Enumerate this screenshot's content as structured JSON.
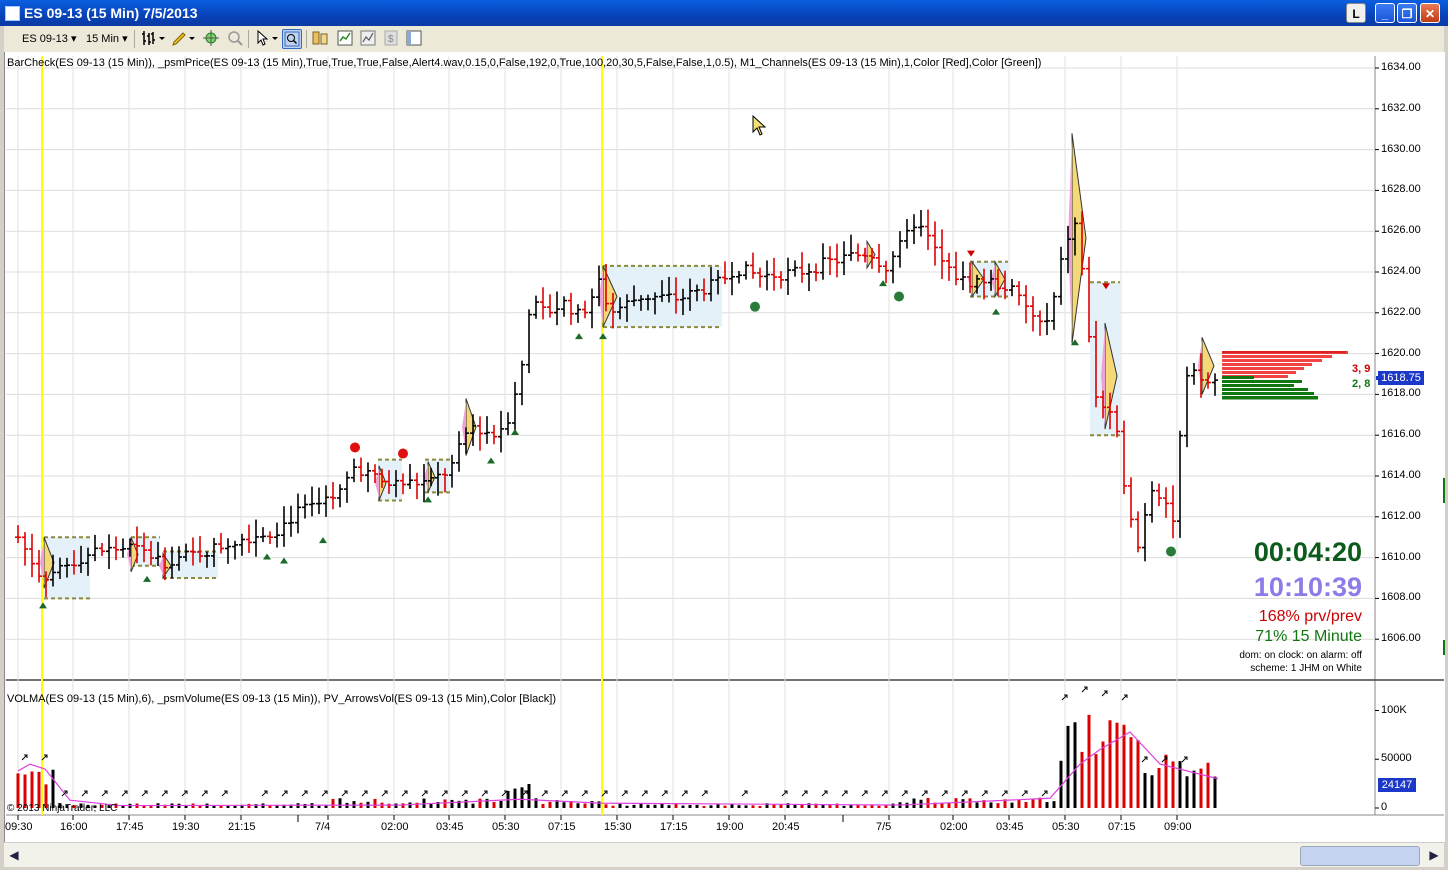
{
  "window": {
    "title": "ES 09-13 (15 Min)  7/5/2013",
    "btn_l": "L",
    "btn_min": "_",
    "btn_max": "❐",
    "btn_close": "✕"
  },
  "toolbar": {
    "instrument": "ES 09-13",
    "interval": "15 Min"
  },
  "price_panel": {
    "indicator_label": "BarCheck(ES 09-13 (15 Min)), _psmPrice(ES 09-13 (15 Min),True,True,True,False,Alert4.wav,0.15,0,False,192,0,True,100,20,30,5,False,False,1,0.5), M1_Channels(ES 09-13 (15 Min),1,Color [Red],Color [Green])",
    "y_ticks": [
      "1634.00",
      "1632.00",
      "1630.00",
      "1628.00",
      "1626.00",
      "1624.00",
      "1622.00",
      "1620.00",
      "1618.00",
      "1616.00",
      "1614.00",
      "1612.00",
      "1610.00",
      "1608.00",
      "1606.00"
    ],
    "current_price": "1618.75",
    "dom_ask": "3, 9",
    "dom_bid": "2, 8",
    "timer": "00:04:20",
    "clock": "10:10:39",
    "pct_prev": "168% prv/prev",
    "pct_interval": "71% 15 Minute",
    "status_line1": "dom: on clock: on alarm: off",
    "status_line2": "scheme: 1 JHM on White",
    "colors": {
      "up": "#000000",
      "down": "#dd0000",
      "ask": "#ee2222",
      "bid": "#117711",
      "session_line": "#ffff00"
    }
  },
  "volume_panel": {
    "indicator_label": "VOLMA(ES 09-13 (15 Min),6), _psmVolume(ES 09-13 (15 Min)), PV_ArrowsVol(ES 09-13 (15 Min),Color [Black])",
    "y_ticks": [
      "100K",
      "50000",
      "0"
    ],
    "current_volume": "24147",
    "copyright": "© 2013 NinjaTrader, LLC"
  },
  "x_axis": {
    "labels": [
      "09:30",
      "16:00",
      "17:45",
      "19:30",
      "21:15",
      "7/4",
      "02:00",
      "03:45",
      "05:30",
      "07:15",
      "15:30",
      "17:15",
      "19:00",
      "20:45",
      "7/5",
      "02:00",
      "03:45",
      "05:30",
      "07:15",
      "09:00"
    ]
  },
  "chart_data": {
    "type": "ohlc",
    "instrument": "ES 09-13",
    "interval": "15 Min",
    "y_range": [
      1604,
      1634.6
    ],
    "bars": [
      {
        "x": "09:30",
        "close": 1611.5
      },
      {
        "x": "16:00",
        "close": 1610.5
      },
      {
        "x": "17:45",
        "close": 1610.3
      },
      {
        "x": "19:30",
        "close": 1610.0
      },
      {
        "x": "21:15",
        "close": 1611.0
      },
      {
        "x": "7/4",
        "close": 1612.5
      },
      {
        "x": "02:00",
        "close": 1614.0
      },
      {
        "x": "03:45",
        "close": 1614.0
      },
      {
        "x": "05:30",
        "close": 1618.0
      },
      {
        "x": "07:15",
        "close": 1622.0
      },
      {
        "x": "15:30",
        "close": 1622.8
      },
      {
        "x": "17:15",
        "close": 1622.8
      },
      {
        "x": "19:00",
        "close": 1623.5
      },
      {
        "x": "20:45",
        "close": 1624.2
      },
      {
        "x": "7/5",
        "close": 1625.0
      },
      {
        "x": "02:00",
        "close": 1623.5
      },
      {
        "x": "03:45",
        "close": 1622.5
      },
      {
        "x": "05:30",
        "close": 1624.0
      },
      {
        "x": "07:15",
        "close": 1612.0
      },
      {
        "x": "09:00",
        "close": 1618.75
      }
    ],
    "last_price": 1618.75,
    "volume": {
      "y_range": [
        0,
        120000
      ],
      "last": 24147
    }
  }
}
